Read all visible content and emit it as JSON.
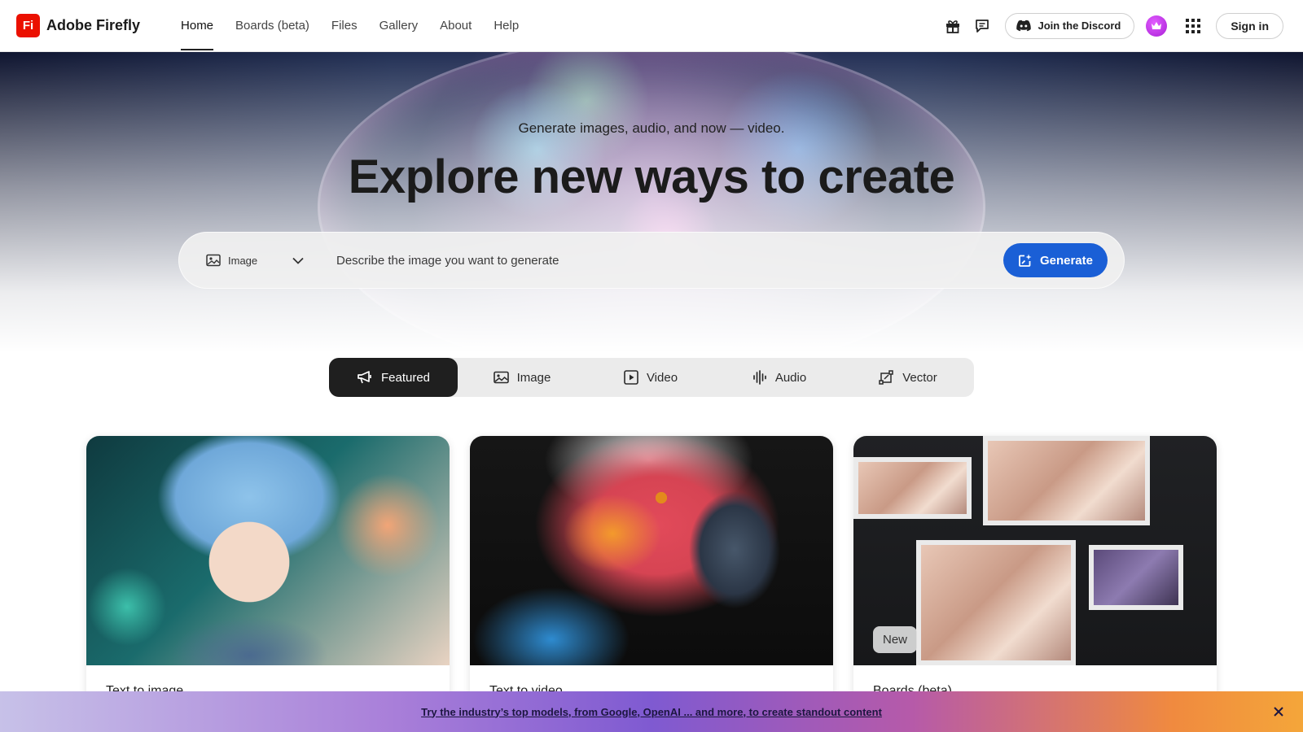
{
  "brand": {
    "logo_text": "Fi",
    "name": "Adobe Firefly",
    "color": "#eb1000"
  },
  "nav": {
    "links": [
      {
        "label": "Home",
        "active": true
      },
      {
        "label": "Boards (beta)"
      },
      {
        "label": "Files"
      },
      {
        "label": "Gallery"
      },
      {
        "label": "About"
      },
      {
        "label": "Help"
      }
    ],
    "right": {
      "gift_icon": "gift-icon",
      "feedback_icon": "chat-feedback-icon",
      "discord_label": "Join the Discord",
      "apps_icon": "app-grid-icon",
      "signin_label": "Sign in"
    }
  },
  "hero": {
    "subtitle": "Generate images, audio, and now — video.",
    "title": "Explore new ways to create",
    "type_select": {
      "selected": "Image"
    },
    "prompt_placeholder": "Describe the image you want to generate",
    "generate_label": "Generate",
    "accent": "#1a5fd6"
  },
  "tabs": [
    {
      "label": "Featured",
      "icon": "megaphone-icon",
      "active": true
    },
    {
      "label": "Image",
      "icon": "image-icon"
    },
    {
      "label": "Video",
      "icon": "video-icon"
    },
    {
      "label": "Audio",
      "icon": "audio-waveform-icon"
    },
    {
      "label": "Vector",
      "icon": "vector-icon"
    }
  ],
  "cards": [
    {
      "title": "Text to image"
    },
    {
      "title": "Text to video"
    },
    {
      "title": "Boards (beta)",
      "badge": "New"
    }
  ],
  "banner": {
    "text": "Try the industry’s top models, from Google, OpenAI ... and more, to create standout content",
    "close_icon": "close-icon"
  }
}
